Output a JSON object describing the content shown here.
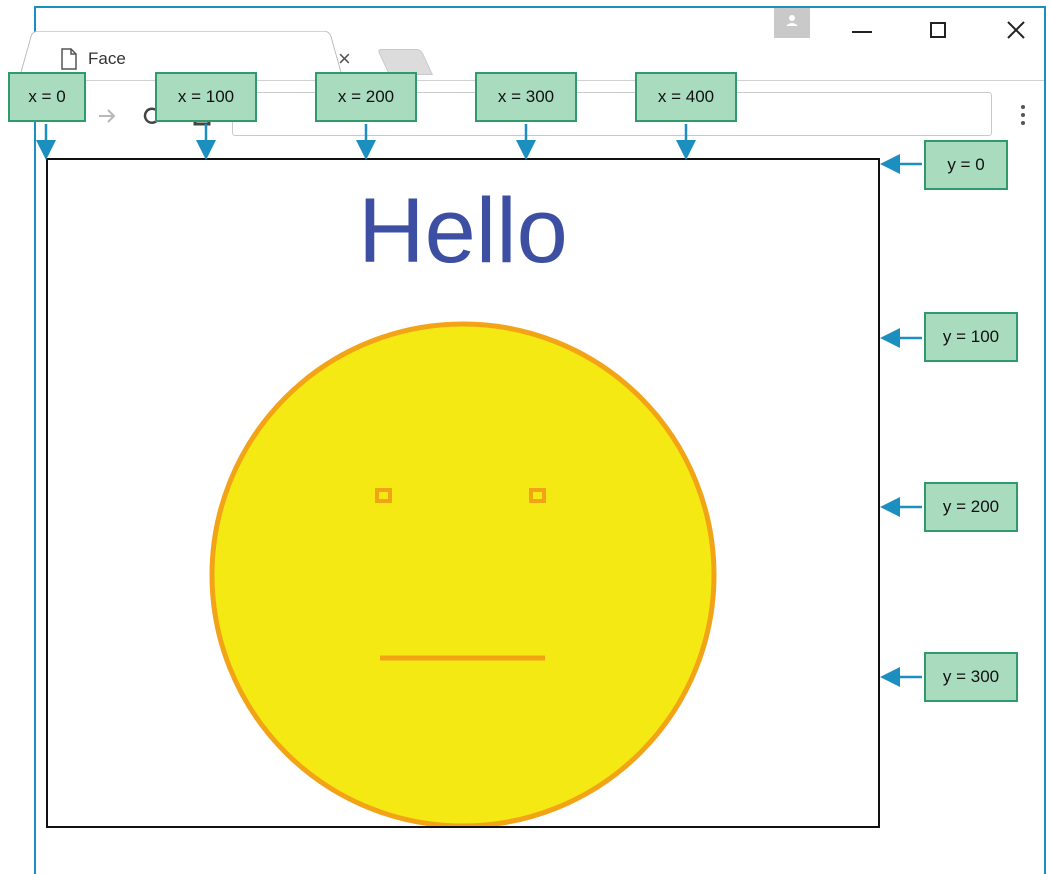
{
  "browser": {
    "tab_title": "Face",
    "tab_close_symbol": "×"
  },
  "page": {
    "greeting": "Hello"
  },
  "face": {
    "fill_color": "#f5e914",
    "stroke_color": "#f3a316"
  },
  "callouts": {
    "x_labels": [
      "x = 0",
      "x = 100",
      "x = 200",
      "x = 300",
      "x = 400"
    ],
    "y_labels": [
      "y = 0",
      "y = 100",
      "y = 200",
      "y = 300"
    ]
  },
  "colors": {
    "callout_fill": "#a9dbbf",
    "callout_border": "#2f9a6c",
    "arrow": "#1a8fc0",
    "hello_text": "#3d4fa3"
  }
}
